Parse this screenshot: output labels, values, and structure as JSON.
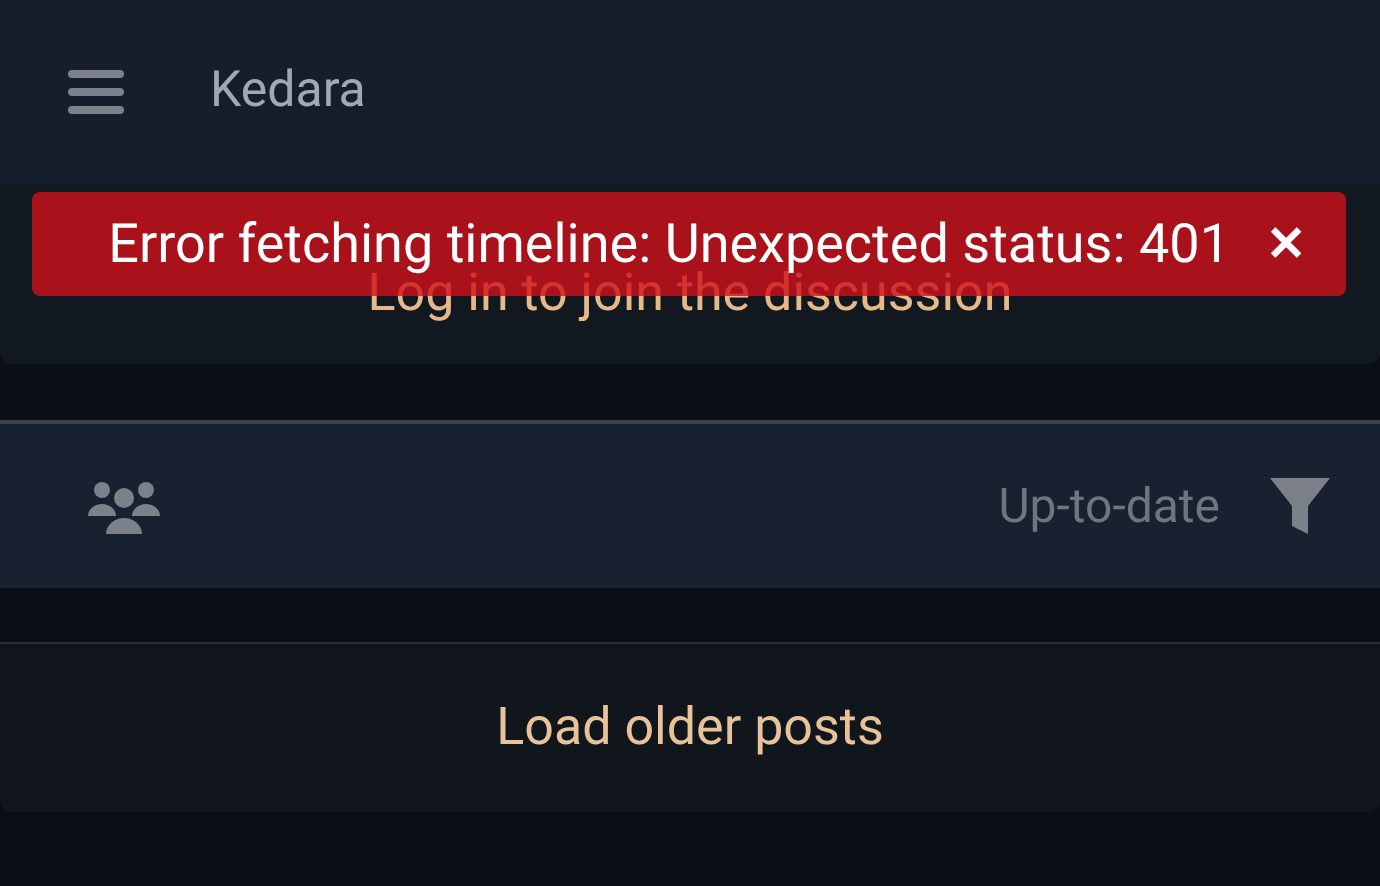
{
  "app_bar": {
    "title": "Kedara"
  },
  "login_prompt": {
    "label": "Log in to join the discussion"
  },
  "error_banner": {
    "message": "Error fetching timeline: Unexpected status: 401",
    "close": "✕"
  },
  "timeline_header": {
    "status": "Up-to-date"
  },
  "load_more": {
    "label": "Load older posts"
  }
}
